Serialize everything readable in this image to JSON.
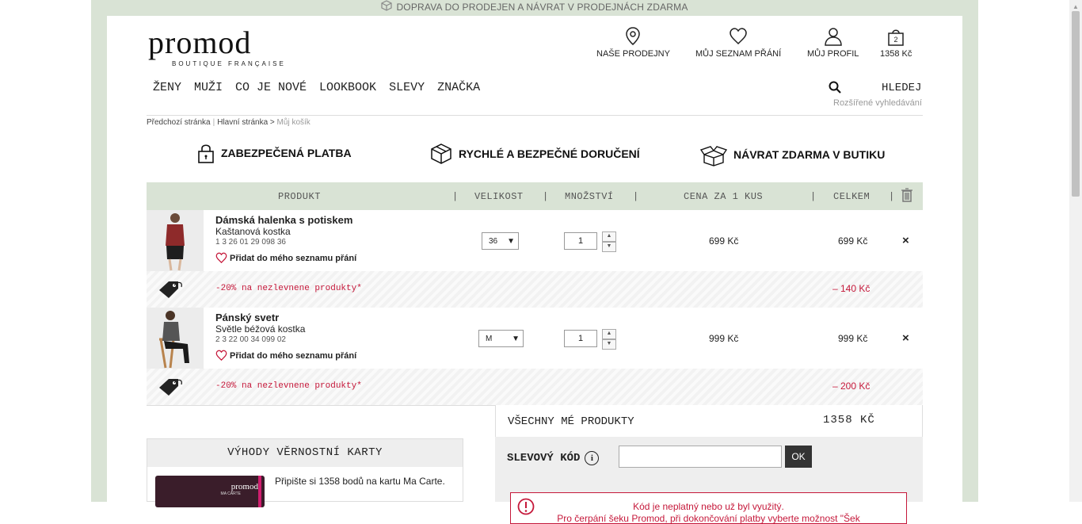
{
  "shipping_banner": "DOPRAVA DO PRODEJEN A NÁVRAT V PRODEJNÁCH ZDARMA",
  "brand": {
    "logo": "promod",
    "tagline": "BOUTIQUE FRANÇAISE"
  },
  "header": {
    "stores": "NAŠE PRODEJNY",
    "wishlist": "MŮJ SEZNAM PŘÁNÍ",
    "profile": "MŮJ PROFIL",
    "cart_count": "2",
    "cart_total": "1358 Kč"
  },
  "nav": [
    "ŽENY",
    "MUŽI",
    "CO JE NOVÉ",
    "LOOKBOOK",
    "SLEVY",
    "ZNAČKA"
  ],
  "search": {
    "label": "HLEDEJ",
    "advanced": "Rozšířené vyhledávání"
  },
  "breadcrumb": {
    "back": "Předchozí stránka",
    "sep": "|",
    "home": "Hlavní stránka",
    "arrow": ">",
    "current": "Můj košík"
  },
  "features": [
    "ZABEZPEČENÁ PLATBA",
    "RYCHLÉ A BEZPEČNÉ DORUČENÍ",
    "NÁVRAT ZDARMA V BUTIKU"
  ],
  "table_header": {
    "product": "PRODUKT",
    "size": "VELIKOST",
    "qty": "MNOŽSTVÍ",
    "unit_price": "CENA ZA 1 KUS",
    "total": "CELKEM",
    "divider": "|"
  },
  "items": [
    {
      "name": "Dámská halenka s potiskem",
      "color": "Kaštanová kostka",
      "ref": "1 3 26 01 29 098 36",
      "wish": "Přidat do mého seznamu přání",
      "size": "36",
      "qty": "1",
      "unit_price": "699 Kč",
      "total": "699 Kč",
      "remove": "×",
      "discount_text": "-20% na nezlevnene produkty*",
      "discount_amount": "– 140 Kč"
    },
    {
      "name": "Pánský svetr",
      "color": "Světle béžová kostka",
      "ref": "2 3 22 00 34 099 02",
      "wish": "Přidat do mého seznamu přání",
      "size": "M",
      "qty": "1",
      "unit_price": "999 Kč",
      "total": "999 Kč",
      "remove": "×",
      "discount_text": "-20% na nezlevnene produkty*",
      "discount_amount": "– 200 Kč"
    }
  ],
  "loyalty": {
    "title": "VÝHODY VĚRNOSTNÍ KARTY",
    "card_logo": "promod",
    "card_sub": "MA CARTE",
    "text": "Připište si 1358 bodů na kartu Ma Carte."
  },
  "summary": {
    "all_products": "VŠECHNY MÉ PRODUKTY",
    "all_total": "1358 KČ",
    "coupon_label": "SLEVOVÝ KÓD",
    "coupon_info": "i",
    "coupon_value": "",
    "ok": "OK"
  },
  "error": {
    "line1": "Kód je neplatný nebo už byl využitý.",
    "line2": "Pro čerpání šeku Promod, při dokončování platby vyberte možnost \"Šek"
  },
  "colors": {
    "accent_green": "#d9e3d5",
    "error_red": "#c5183a"
  }
}
